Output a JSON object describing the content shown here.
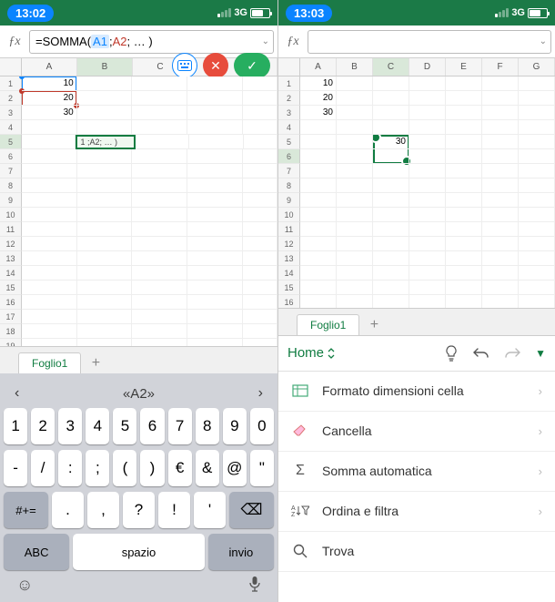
{
  "left": {
    "status": {
      "time": "13:02",
      "network": "3G"
    },
    "formula": {
      "prefix": "=SOMMA(",
      "ref1": "A1",
      "sep1": ";",
      "ref2": "A2",
      "suffix": "; … )"
    },
    "cells": {
      "A1": "10",
      "A2": "20",
      "A3": "30",
      "B5_editing": "1 ;A2; … )"
    },
    "sheet": {
      "name": "Foglio1"
    },
    "keyboard": {
      "suggestion": "«A2»",
      "row1": [
        "1",
        "2",
        "3",
        "4",
        "5",
        "6",
        "7",
        "8",
        "9",
        "0"
      ],
      "row2": [
        "-",
        "/",
        ":",
        ";",
        "(",
        ")",
        "€",
        "&",
        "@",
        "\""
      ],
      "row3_shift": "#+=",
      "row3": [
        ".",
        ",",
        "?",
        "!",
        "'"
      ],
      "row3_del": "⌫",
      "abc": "ABC",
      "space": "spazio",
      "enter": "invio"
    }
  },
  "right": {
    "status": {
      "time": "13:03",
      "network": "3G"
    },
    "cells": {
      "A1": "10",
      "A2": "20",
      "A3": "30",
      "C5": "30"
    },
    "sheet": {
      "name": "Foglio1"
    },
    "ribbon": {
      "tab": "Home"
    },
    "menu": {
      "format": "Formato dimensioni cella",
      "clear": "Cancella",
      "autosum": "Somma automatica",
      "sort": "Ordina e filtra",
      "find": "Trova"
    }
  }
}
